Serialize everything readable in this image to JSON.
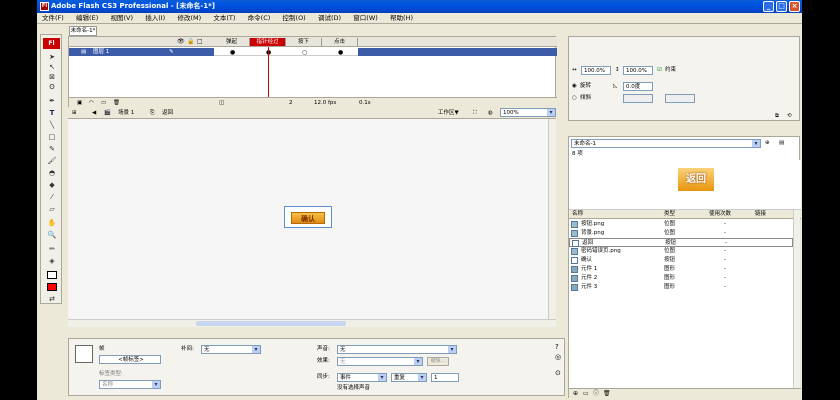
{
  "window": {
    "title": "Adobe Flash CS3 Professional - [未命名-1*]"
  },
  "menu": [
    "文件(F)",
    "编辑(E)",
    "视图(V)",
    "插入(I)",
    "修改(M)",
    "文本(T)",
    "命令(C)",
    "控制(O)",
    "调试(D)",
    "窗口(W)",
    "帮助(H)"
  ],
  "toolbox": {
    "logo": "Fl"
  },
  "document": {
    "tab": "未命名-1*"
  },
  "timeline": {
    "frame_labels": [
      "弹起",
      "指针经过",
      "按下",
      "点击"
    ],
    "layer": "图层 1",
    "current_frame": "2",
    "fps": "12.0 fps",
    "time": "0.1s"
  },
  "editbar": {
    "scene": "场景 1",
    "symbol": "返回",
    "workspace": "工作区▼",
    "zoom": "100%"
  },
  "stage": {
    "button_text": "确认"
  },
  "properties": {
    "type": "帧",
    "frame_label_placeholder": "<帧标签>",
    "label_type": "标签类型:",
    "label_type_value": "名称",
    "tween_label": "补间:",
    "tween_value": "无",
    "sound_label": "声音:",
    "sound_value": "无",
    "effect_label": "效果:",
    "effect_value": "无",
    "edit_btn": "编辑...",
    "sync_label": "同步:",
    "sync_value": "事件",
    "repeat_value": "重复",
    "repeat_count": "1",
    "no_sound": "没有选择声音"
  },
  "transform": {
    "width": "100.0%",
    "height": "100.0%",
    "constrain": "约束",
    "rotate": "旋转",
    "rotate_value": "0.0度",
    "skew": "倾斜"
  },
  "library": {
    "doc": "未命名-1",
    "count": "8 项",
    "preview_text": "返回",
    "headers": {
      "name": "名称",
      "type": "类型",
      "uses": "使用次数",
      "link": "链接"
    },
    "items": [
      {
        "name": "按钮.png",
        "type": "位图",
        "uses": "-"
      },
      {
        "name": "背景.png",
        "type": "位图",
        "uses": "-"
      },
      {
        "name": "返回",
        "type": "按钮",
        "uses": "-"
      },
      {
        "name": "密码错误页.png",
        "type": "位图",
        "uses": "-"
      },
      {
        "name": "确认",
        "type": "按钮",
        "uses": "-"
      },
      {
        "name": "元件 1",
        "type": "图形",
        "uses": "-"
      },
      {
        "name": "元件 2",
        "type": "图形",
        "uses": "-"
      },
      {
        "name": "元件 3",
        "type": "图形",
        "uses": "-"
      }
    ]
  },
  "colors": {
    "titlebar": "#0054E3",
    "layer_selected": "#3C5CAA",
    "playhead": "#CC0000"
  }
}
